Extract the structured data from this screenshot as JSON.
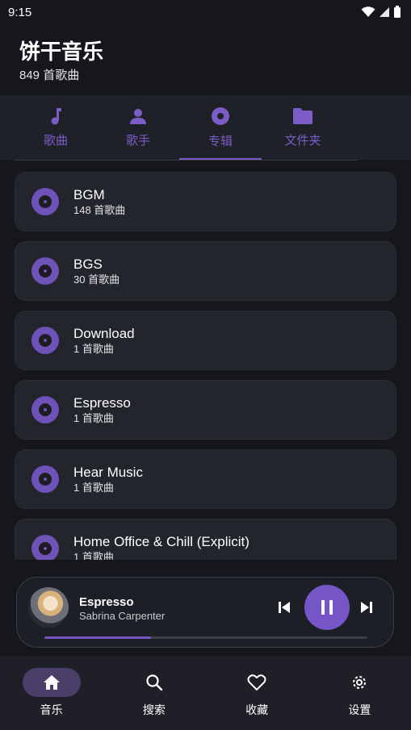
{
  "status": {
    "time": "9:15"
  },
  "header": {
    "title": "饼干音乐",
    "subtitle": "849 首歌曲"
  },
  "tabs": [
    {
      "label": "歌曲",
      "icon": "music-note-icon"
    },
    {
      "label": "歌手",
      "icon": "person-icon"
    },
    {
      "label": "专辑",
      "icon": "disc-icon"
    },
    {
      "label": "文件夹",
      "icon": "folder-icon"
    }
  ],
  "active_tab": "专辑",
  "albums": [
    {
      "name": "BGM",
      "count": "148 首歌曲"
    },
    {
      "name": "BGS",
      "count": "30 首歌曲"
    },
    {
      "name": "Download",
      "count": "1 首歌曲"
    },
    {
      "name": "Espresso",
      "count": "1 首歌曲"
    },
    {
      "name": "Hear Music",
      "count": "1 首歌曲"
    },
    {
      "name": "Home Office & Chill (Explicit)",
      "count": "1 首歌曲"
    }
  ],
  "player": {
    "title": "Espresso",
    "artist": "Sabrina Carpenter",
    "progress": 0.33
  },
  "bottom_nav": [
    {
      "label": "音乐",
      "icon": "home-icon"
    },
    {
      "label": "搜索",
      "icon": "search-icon"
    },
    {
      "label": "收藏",
      "icon": "heart-icon"
    },
    {
      "label": "设置",
      "icon": "gear-icon"
    }
  ],
  "colors": {
    "accent": "#7655c6",
    "background": "#16171c",
    "card": "#23252c"
  }
}
